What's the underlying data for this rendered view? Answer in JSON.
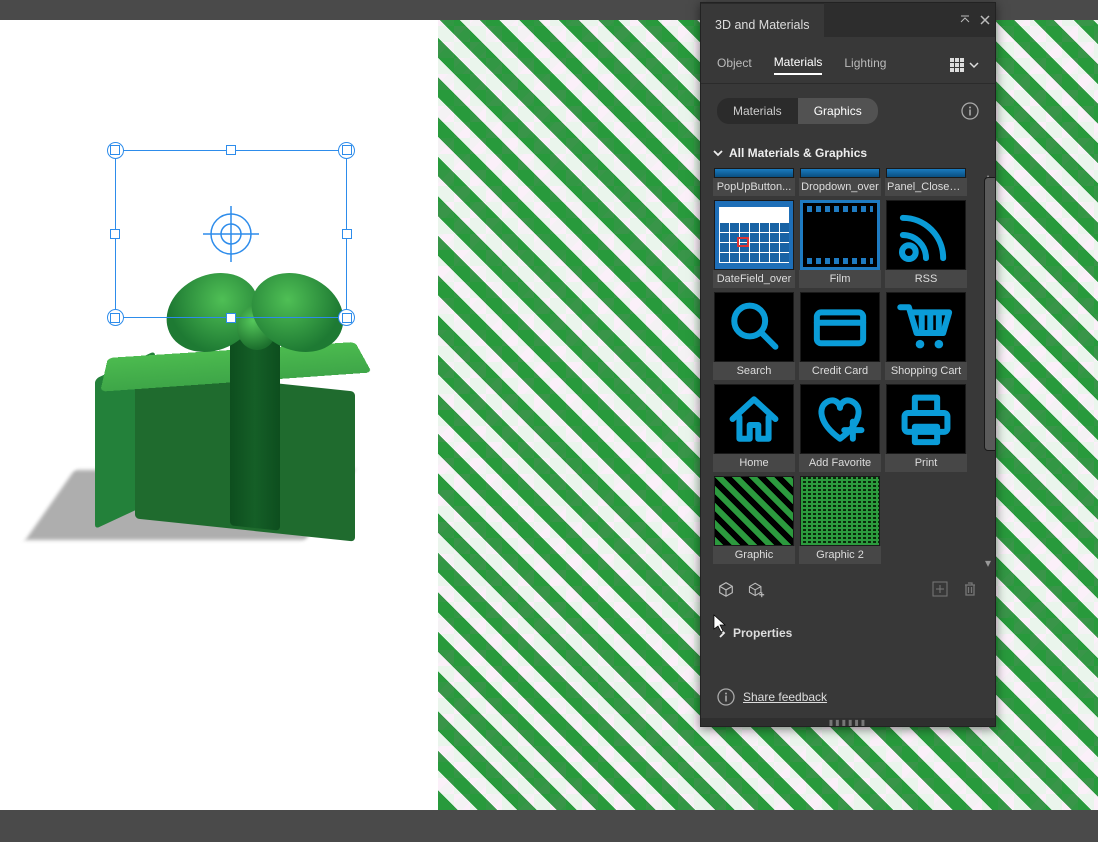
{
  "panel": {
    "title": "3D and Materials",
    "subtabs": {
      "object": "Object",
      "materials": "Materials",
      "lighting": "Lighting"
    },
    "pills": {
      "materials": "Materials",
      "graphics": "Graphics"
    },
    "section_title": "All Materials & Graphics",
    "tiles": [
      {
        "id": "popupbutton",
        "label": "PopUpButton..."
      },
      {
        "id": "dropdown",
        "label": "Dropdown_over"
      },
      {
        "id": "panelclose",
        "label": "Panel_CloseB..."
      },
      {
        "id": "datefield",
        "label": "DateField_over"
      },
      {
        "id": "film",
        "label": "Film"
      },
      {
        "id": "rss",
        "label": "RSS"
      },
      {
        "id": "search",
        "label": "Search"
      },
      {
        "id": "creditcard",
        "label": "Credit Card"
      },
      {
        "id": "cart",
        "label": "Shopping Cart"
      },
      {
        "id": "home",
        "label": "Home"
      },
      {
        "id": "addfavorite",
        "label": "Add Favorite"
      },
      {
        "id": "print",
        "label": "Print"
      },
      {
        "id": "graphic",
        "label": "Graphic"
      },
      {
        "id": "graphic2",
        "label": "Graphic 2"
      }
    ],
    "properties_title": "Properties",
    "feedback_label": "Share feedback"
  }
}
